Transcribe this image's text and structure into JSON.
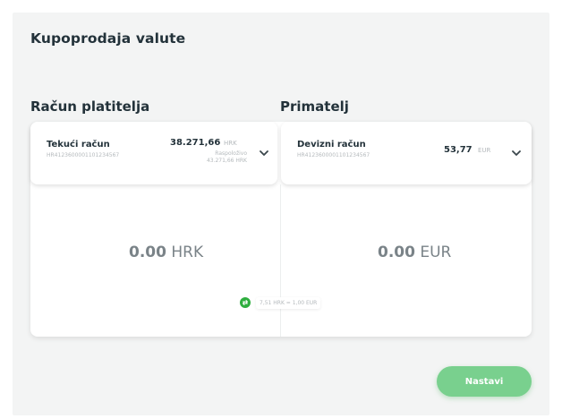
{
  "title": "Kupoprodaja valute",
  "payer_label": "Račun platitelja",
  "recipient_label": "Primatelj",
  "payer_account": {
    "name": "Tekući račun",
    "iban": "HR4123600001101234567",
    "balance": "38.271,66",
    "currency": "HRK",
    "sub_line1": "Raspoloživo",
    "sub_line2": "43.271,66 HRK",
    "chevron_icon": "chevron-down-icon"
  },
  "recipient_account": {
    "name": "Devizni račun",
    "iban": "HR4123600001101234567",
    "balance": "53,77",
    "currency": "EUR",
    "chevron_icon": "chevron-down-icon"
  },
  "from_amount": {
    "value": "0.00",
    "currency": "HRK"
  },
  "to_amount": {
    "value": "0.00",
    "currency": "EUR"
  },
  "exchange_rate": {
    "text": "7,51 HRK = 1,00 EUR",
    "icon": "swap-icon"
  },
  "submit_label": "Nastavi",
  "colors": {
    "accent": "#2fae3f",
    "button": "#79d08e",
    "panel": "#f3f4f4"
  }
}
